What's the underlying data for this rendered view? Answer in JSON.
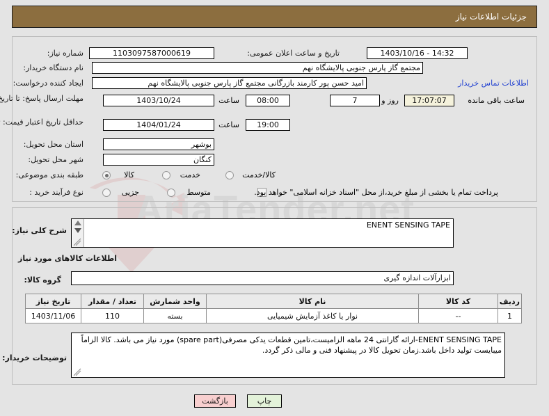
{
  "header": {
    "title": "جزئیات اطلاعات نیاز",
    "bar_color": "#8c6e3f"
  },
  "form": {
    "need_number_label": "شماره نیاز:",
    "need_number_value": "1103097587000619",
    "announce_label": "تاریخ و ساعت اعلان عمومی:",
    "announce_value": "14:32 - 1403/10/16",
    "buyer_org_label": "نام دستگاه خریدار:",
    "buyer_org_value": "مجتمع گاز پارس جنوبی  پالایشگاه نهم",
    "creator_label": "ایجاد کننده درخواست:",
    "creator_value": "امید حسن پور کارمند بازرگانی مجتمع گاز پارس جنوبی  پالایشگاه نهم",
    "contact_link": "اطلاعات تماس خریدار",
    "deadline_label": "مهلت ارسال پاسخ: تا تاریخ:",
    "deadline_date": "1403/10/24",
    "deadline_hour_label": "ساعت",
    "deadline_hour": "08:00",
    "days_value": "7",
    "days_label": "روز و",
    "countdown_value": "17:07:07",
    "countdown_label": "ساعت باقی مانده",
    "price_validity_label": "حداقل تاریخ اعتبار قیمت: تا تاریخ:",
    "price_validity_date": "1404/01/24",
    "price_validity_hour_label": "ساعت",
    "price_validity_hour": "19:00",
    "province_label": "استان محل تحویل:",
    "province_value": "بوشهر",
    "city_label": "شهر محل تحویل:",
    "city_value": "کنگان",
    "category_label": "طبقه بندی موضوعی:",
    "category_options": [
      "کالا",
      "خدمت",
      "کالا/خدمت"
    ],
    "category_selected_index": 0,
    "process_label": "نوع فرآیند خرید :",
    "process_options": [
      "جزیی",
      "متوسط"
    ],
    "process_selected_index": -1,
    "treasury_checkbox_label": "پرداخت تمام یا بخشی از مبلغ خرید،از محل \"اسناد خزانه اسلامی\" خواهد بود.",
    "treasury_checked": false
  },
  "middle": {
    "summary_label": "شرح کلی نیاز:",
    "summary_value": "ENENT SENSING TAPE",
    "goods_section_title": "اطلاعات کالاهای مورد نیاز",
    "goods_group_label": "گروه کالا:",
    "goods_group_value": "ابزارآلات اندازه گیری"
  },
  "table": {
    "headers": [
      "ردیف",
      "کد کالا",
      "نام کالا",
      "واحد شمارش",
      "تعداد / مقدار",
      "تاریخ نیاز"
    ],
    "rows": [
      {
        "row": "1",
        "code": "--",
        "name": "نوار یا کاغذ آزمایش شیمیایی",
        "unit": "بسته",
        "qty": "110",
        "date": "1403/11/06"
      }
    ]
  },
  "notes": {
    "label": "توضیحات خریدار:",
    "value": "ENENT SENSING TAPE-ارائه گارانتی 24 ماهه الزامیست،تامین قطعات یدکی مصرفی(spare part) مورد نیاز می باشد. کالا الزاماً میبایست تولید داخل باشد.زمان تحویل کالا در پیشنهاد فنی و مالی ذکر گردد."
  },
  "footer": {
    "back_label": "بازگشت",
    "print_label": "چاپ"
  },
  "watermark": {
    "text": "AriaTender.net"
  }
}
